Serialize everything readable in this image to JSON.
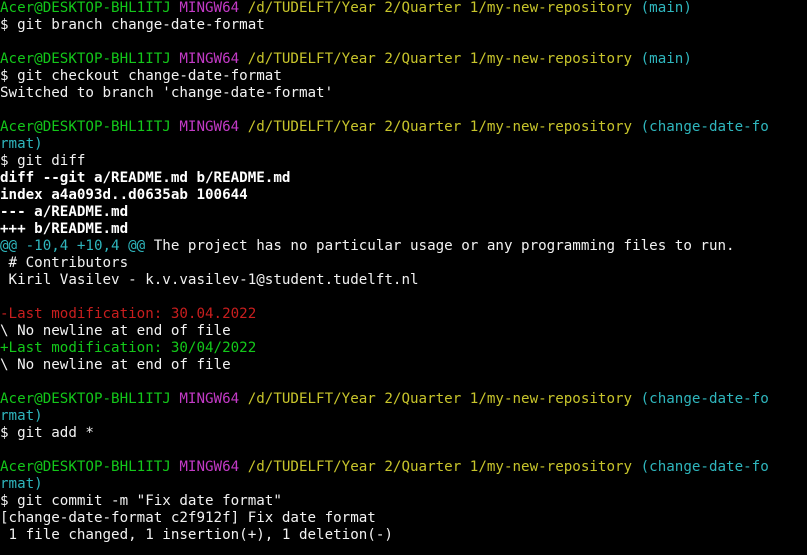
{
  "terminal": {
    "colors": {
      "background": "#000000",
      "text": "#ffffff",
      "green": "#13c81a",
      "magenta": "#c33ac6",
      "yellow": "#c7c42b",
      "cyan": "#2fb6bd",
      "red": "#c81e1e"
    },
    "lines": [
      [
        {
          "t": "Acer@DESKTOP-BHL1ITJ ",
          "c": "green"
        },
        {
          "t": "MINGW64 ",
          "c": "magenta"
        },
        {
          "t": "/d/TUDELFT/Year 2/Quarter 1/my-new-repository ",
          "c": "yellow"
        },
        {
          "t": "(main)",
          "c": "cyan"
        }
      ],
      [
        {
          "t": "$ git branch change-date-format",
          "c": "white"
        }
      ],
      [],
      [
        {
          "t": "Acer@DESKTOP-BHL1ITJ ",
          "c": "green"
        },
        {
          "t": "MINGW64 ",
          "c": "magenta"
        },
        {
          "t": "/d/TUDELFT/Year 2/Quarter 1/my-new-repository ",
          "c": "yellow"
        },
        {
          "t": "(main)",
          "c": "cyan"
        }
      ],
      [
        {
          "t": "$ git checkout change-date-format",
          "c": "white"
        }
      ],
      [
        {
          "t": "Switched to branch 'change-date-format'",
          "c": "white"
        }
      ],
      [],
      [
        {
          "t": "Acer@DESKTOP-BHL1ITJ ",
          "c": "green"
        },
        {
          "t": "MINGW64 ",
          "c": "magenta"
        },
        {
          "t": "/d/TUDELFT/Year 2/Quarter 1/my-new-repository ",
          "c": "yellow"
        },
        {
          "t": "(change-date-fo",
          "c": "cyan"
        }
      ],
      [
        {
          "t": "rmat)",
          "c": "cyan"
        }
      ],
      [
        {
          "t": "$ git diff",
          "c": "white"
        }
      ],
      [
        {
          "t": "diff --git a/README.md b/README.md",
          "c": "bold"
        }
      ],
      [
        {
          "t": "index a4a093d..d0635ab 100644",
          "c": "bold"
        }
      ],
      [
        {
          "t": "--- a/README.md",
          "c": "bold"
        }
      ],
      [
        {
          "t": "+++ b/README.md",
          "c": "bold"
        }
      ],
      [
        {
          "t": "@@ -10,4 +10,4 @@",
          "c": "cyan"
        },
        {
          "t": " The project has no particular usage or any programming files to run.",
          "c": "white"
        }
      ],
      [
        {
          "t": " # Contributors",
          "c": "white"
        }
      ],
      [
        {
          "t": " Kiril Vasilev - k.v.vasilev-1@student.tudelft.nl",
          "c": "white"
        }
      ],
      [],
      [
        {
          "t": "-Last modification: 30.04.2022",
          "c": "red"
        }
      ],
      [
        {
          "t": "\\ No newline at end of file",
          "c": "white"
        }
      ],
      [
        {
          "t": "+Last modification: 30/04/2022",
          "c": "green"
        }
      ],
      [
        {
          "t": "\\ No newline at end of file",
          "c": "white"
        }
      ],
      [],
      [
        {
          "t": "Acer@DESKTOP-BHL1ITJ ",
          "c": "green"
        },
        {
          "t": "MINGW64 ",
          "c": "magenta"
        },
        {
          "t": "/d/TUDELFT/Year 2/Quarter 1/my-new-repository ",
          "c": "yellow"
        },
        {
          "t": "(change-date-fo",
          "c": "cyan"
        }
      ],
      [
        {
          "t": "rmat)",
          "c": "cyan"
        }
      ],
      [
        {
          "t": "$ git add *",
          "c": "white"
        }
      ],
      [],
      [
        {
          "t": "Acer@DESKTOP-BHL1ITJ ",
          "c": "green"
        },
        {
          "t": "MINGW64 ",
          "c": "magenta"
        },
        {
          "t": "/d/TUDELFT/Year 2/Quarter 1/my-new-repository ",
          "c": "yellow"
        },
        {
          "t": "(change-date-fo",
          "c": "cyan"
        }
      ],
      [
        {
          "t": "rmat)",
          "c": "cyan"
        }
      ],
      [
        {
          "t": "$ git commit -m \"Fix date format\"",
          "c": "white"
        }
      ],
      [
        {
          "t": "[change-date-format c2f912f] Fix date format",
          "c": "white"
        }
      ],
      [
        {
          "t": " 1 file changed, 1 insertion(+), 1 deletion(-)",
          "c": "white"
        }
      ]
    ]
  }
}
